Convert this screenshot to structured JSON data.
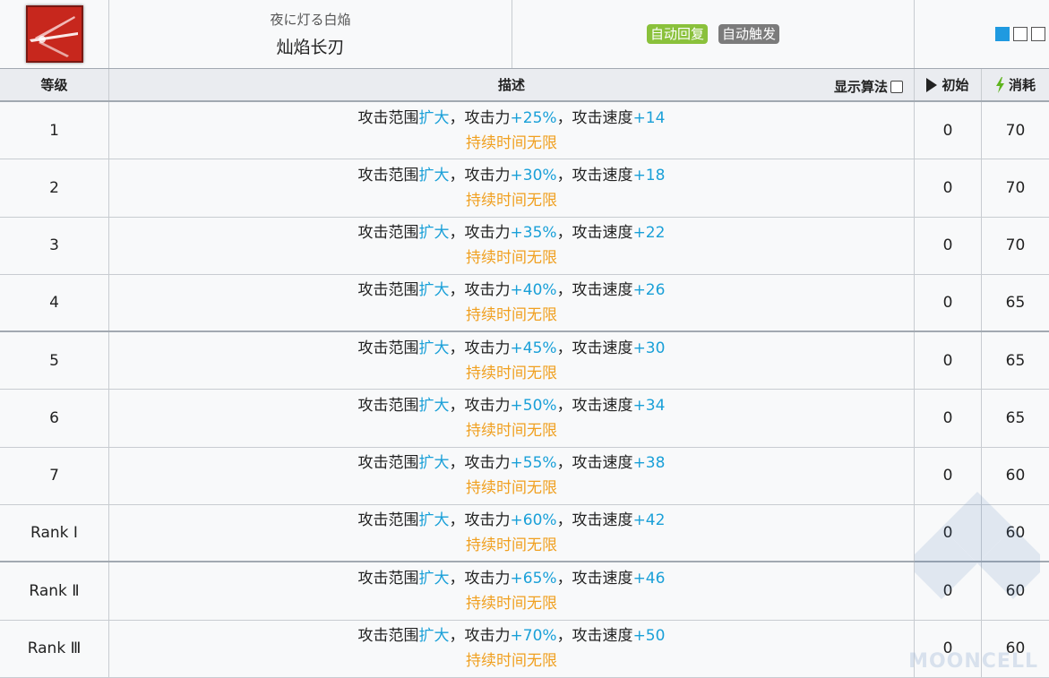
{
  "skill": {
    "name_jp": "夜に灯る白焔",
    "name_zh": "灿焰长刃",
    "tags": [
      "自动回复",
      "自动触发"
    ]
  },
  "header": {
    "level": "等级",
    "description": "描述",
    "formula_toggle": "显示算法",
    "initial": "初始",
    "cost": "消耗"
  },
  "rows": [
    {
      "level": "1",
      "p1": "攻击范围",
      "p2": "扩大",
      "p3": "，攻击力",
      "p4": "+25%",
      "p5": "，攻击速度",
      "p6": "+14",
      "duration": "持续时间无限",
      "initial": "0",
      "cost": "70"
    },
    {
      "level": "2",
      "p1": "攻击范围",
      "p2": "扩大",
      "p3": "，攻击力",
      "p4": "+30%",
      "p5": "，攻击速度",
      "p6": "+18",
      "duration": "持续时间无限",
      "initial": "0",
      "cost": "70"
    },
    {
      "level": "3",
      "p1": "攻击范围",
      "p2": "扩大",
      "p3": "，攻击力",
      "p4": "+35%",
      "p5": "，攻击速度",
      "p6": "+22",
      "duration": "持续时间无限",
      "initial": "0",
      "cost": "70"
    },
    {
      "level": "4",
      "p1": "攻击范围",
      "p2": "扩大",
      "p3": "，攻击力",
      "p4": "+40%",
      "p5": "，攻击速度",
      "p6": "+26",
      "duration": "持续时间无限",
      "initial": "0",
      "cost": "65"
    },
    {
      "level": "5",
      "p1": "攻击范围",
      "p2": "扩大",
      "p3": "，攻击力",
      "p4": "+45%",
      "p5": "，攻击速度",
      "p6": "+30",
      "duration": "持续时间无限",
      "initial": "0",
      "cost": "65"
    },
    {
      "level": "6",
      "p1": "攻击范围",
      "p2": "扩大",
      "p3": "，攻击力",
      "p4": "+50%",
      "p5": "，攻击速度",
      "p6": "+34",
      "duration": "持续时间无限",
      "initial": "0",
      "cost": "65"
    },
    {
      "level": "7",
      "p1": "攻击范围",
      "p2": "扩大",
      "p3": "，攻击力",
      "p4": "+55%",
      "p5": "，攻击速度",
      "p6": "+38",
      "duration": "持续时间无限",
      "initial": "0",
      "cost": "60"
    },
    {
      "level": "Rank Ⅰ",
      "p1": "攻击范围",
      "p2": "扩大",
      "p3": "，攻击力",
      "p4": "+60%",
      "p5": "，攻击速度",
      "p6": "+42",
      "duration": "持续时间无限",
      "initial": "0",
      "cost": "60"
    },
    {
      "level": "Rank Ⅱ",
      "p1": "攻击范围",
      "p2": "扩大",
      "p3": "，攻击力",
      "p4": "+65%",
      "p5": "，攻击速度",
      "p6": "+46",
      "duration": "持续时间无限",
      "initial": "0",
      "cost": "60"
    },
    {
      "level": "Rank Ⅲ",
      "p1": "攻击范围",
      "p2": "扩大",
      "p3": "，攻击力",
      "p4": "+70%",
      "p5": "，攻击速度",
      "p6": "+50",
      "duration": "持续时间无限",
      "initial": "0",
      "cost": "60"
    }
  ],
  "watermark": "MOONCELL",
  "colors": {
    "accent_blue": "#1aa0d8",
    "duration_orange": "#f0a020",
    "tag_green": "#8ac13b",
    "tag_grey": "#7b7b7b"
  },
  "icons": [
    "skill-icon",
    "play-icon",
    "bolt-icon",
    "view-toggle-icon"
  ]
}
